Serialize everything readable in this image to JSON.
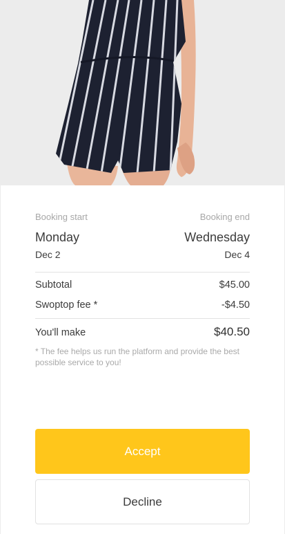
{
  "product": {
    "image_alt": "striped-romper-photo",
    "icon": "product-photo"
  },
  "booking": {
    "start_label": "Booking start",
    "end_label": "Booking end",
    "start_day": "Monday",
    "end_day": "Wednesday",
    "start_date": "Dec 2",
    "end_date": "Dec 4"
  },
  "pricing": {
    "subtotal_label": "Subtotal",
    "subtotal_value": "$45.00",
    "fee_label": "Swoptop fee *",
    "fee_value": "-$4.50",
    "total_label": "You'll make",
    "total_value": "$40.50",
    "note": "* The fee helps us run the platform and provide the best possible service to you!"
  },
  "actions": {
    "accept_label": "Accept",
    "decline_label": "Decline"
  },
  "colors": {
    "accent": "#ffc61b",
    "muted_text": "#a7a7a7",
    "body_text": "#3b3b3b",
    "divider": "#e2e2e2"
  }
}
